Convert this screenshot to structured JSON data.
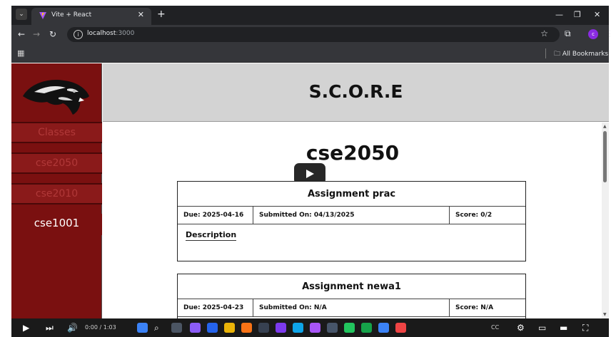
{
  "browser": {
    "tab_title": "Vite + React",
    "url_host": "localhost",
    "url_port": ":3000",
    "bookmarks_folder": "All Bookmarks",
    "profile_initial": "c"
  },
  "app": {
    "title": "S.C.O.R.E",
    "sidebar": {
      "header": "Classes",
      "items": [
        {
          "label": "cse2050",
          "active": false
        },
        {
          "label": "cse2010",
          "active": false
        },
        {
          "label": "cse1001",
          "active": true
        }
      ]
    },
    "class_title": "cse2050",
    "assignments": [
      {
        "name": "Assignment prac",
        "due": "Due: 2025-04-16",
        "submitted": "Submitted On: 04/13/2025",
        "score": "Score: 0/2",
        "description_label": "Description"
      },
      {
        "name": "Assignment newa1",
        "due": "Due: 2025-04-23",
        "submitted": "Submitted On: N/A",
        "score": "Score: N/A"
      }
    ]
  },
  "player": {
    "time": "0:00 / 1:03"
  },
  "icons": {
    "play_icon": "play-icon",
    "next_icon": "next-icon",
    "volume_icon": "volume-icon",
    "search_icon": "search-icon",
    "settings_icon": "gear-icon",
    "fullscreen_icon": "fullscreen-icon"
  },
  "colors": {
    "sidebar": "#7a1010",
    "header_bg": "#d3d3d3",
    "chrome_dark": "#202124",
    "chrome_toolbar": "#35363a"
  }
}
